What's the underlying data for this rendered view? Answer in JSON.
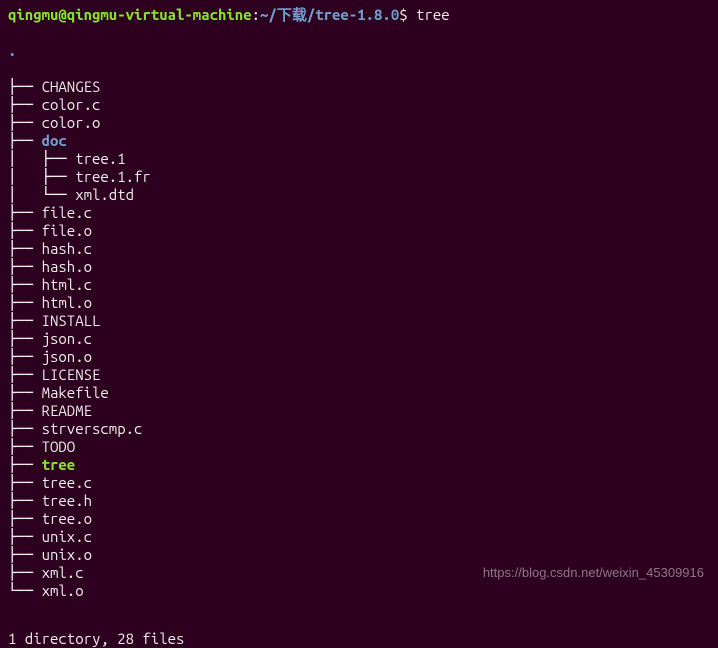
{
  "prompt": {
    "user_host": "qingmu@qingmu-virtual-machine",
    "separator": ":",
    "path_tilde": "~/",
    "path_rest": "下载/tree-1.8.0",
    "dollar": "$ ",
    "command": "tree"
  },
  "root_dot": ".",
  "tree": [
    {
      "branch": "├── ",
      "name": "CHANGES",
      "type": "plain"
    },
    {
      "branch": "├── ",
      "name": "color.c",
      "type": "plain"
    },
    {
      "branch": "├── ",
      "name": "color.o",
      "type": "plain"
    },
    {
      "branch": "├── ",
      "name": "doc",
      "type": "dir"
    },
    {
      "branch": "│   ├── ",
      "name": "tree.1",
      "type": "plain"
    },
    {
      "branch": "│   ├── ",
      "name": "tree.1.fr",
      "type": "plain"
    },
    {
      "branch": "│   └── ",
      "name": "xml.dtd",
      "type": "plain"
    },
    {
      "branch": "├── ",
      "name": "file.c",
      "type": "plain"
    },
    {
      "branch": "├── ",
      "name": "file.o",
      "type": "plain"
    },
    {
      "branch": "├── ",
      "name": "hash.c",
      "type": "plain"
    },
    {
      "branch": "├── ",
      "name": "hash.o",
      "type": "plain"
    },
    {
      "branch": "├── ",
      "name": "html.c",
      "type": "plain"
    },
    {
      "branch": "├── ",
      "name": "html.o",
      "type": "plain"
    },
    {
      "branch": "├── ",
      "name": "INSTALL",
      "type": "plain"
    },
    {
      "branch": "├── ",
      "name": "json.c",
      "type": "plain"
    },
    {
      "branch": "├── ",
      "name": "json.o",
      "type": "plain"
    },
    {
      "branch": "├── ",
      "name": "LICENSE",
      "type": "plain"
    },
    {
      "branch": "├── ",
      "name": "Makefile",
      "type": "plain"
    },
    {
      "branch": "├── ",
      "name": "README",
      "type": "plain"
    },
    {
      "branch": "├── ",
      "name": "strverscmp.c",
      "type": "plain"
    },
    {
      "branch": "├── ",
      "name": "TODO",
      "type": "plain"
    },
    {
      "branch": "├── ",
      "name": "tree",
      "type": "exec"
    },
    {
      "branch": "├── ",
      "name": "tree.c",
      "type": "plain"
    },
    {
      "branch": "├── ",
      "name": "tree.h",
      "type": "plain"
    },
    {
      "branch": "├── ",
      "name": "tree.o",
      "type": "plain"
    },
    {
      "branch": "├── ",
      "name": "unix.c",
      "type": "plain"
    },
    {
      "branch": "├── ",
      "name": "unix.o",
      "type": "plain"
    },
    {
      "branch": "├── ",
      "name": "xml.c",
      "type": "plain"
    },
    {
      "branch": "└── ",
      "name": "xml.o",
      "type": "plain"
    }
  ],
  "summary": "1 directory, 28 files",
  "watermark": "https://blog.csdn.net/weixin_45309916"
}
